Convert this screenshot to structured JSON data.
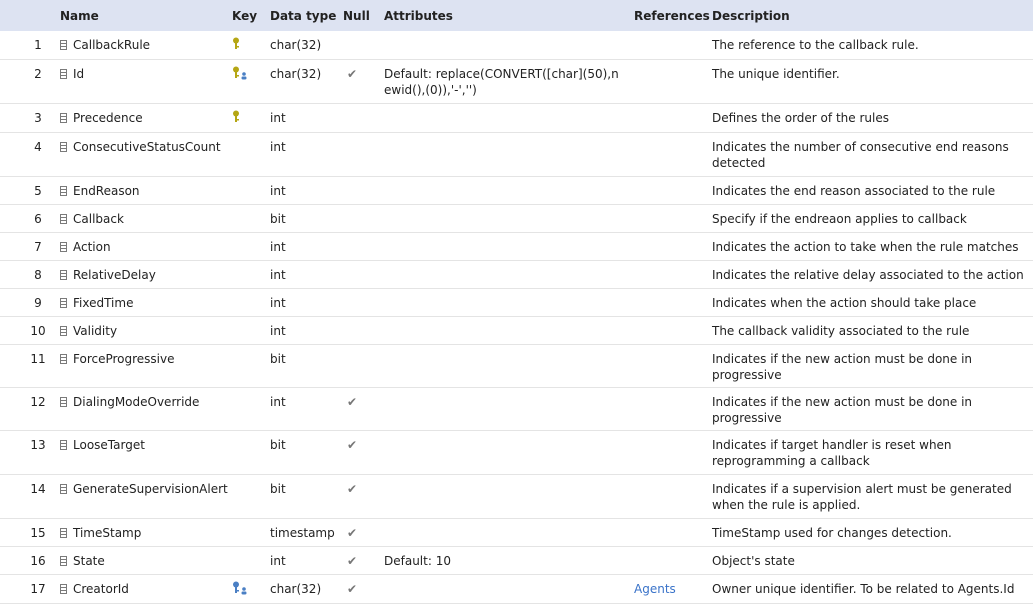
{
  "headers": {
    "num": "",
    "name": "Name",
    "key": "Key",
    "datatype": "Data type",
    "null": "Null",
    "attributes": "Attributes",
    "references": "References",
    "description": "Description"
  },
  "colors": {
    "header_bg": "#dde3f2",
    "pk_key": "#b5a614",
    "fk_key": "#4a7fc4",
    "link": "#3a73c9"
  },
  "rows": [
    {
      "num": "1",
      "name": "CallbackRule",
      "key": "pk",
      "datatype": "char(32)",
      "null": "",
      "attributes": "",
      "references": "",
      "description": "The reference to the callback rule."
    },
    {
      "num": "2",
      "name": "Id",
      "key": "pk-unique",
      "datatype": "char(32)",
      "null": "✔",
      "attributes": "Default: replace(CONVERT([char](50),newid(),(0)),'-','')",
      "references": "",
      "description": "The unique identifier."
    },
    {
      "num": "3",
      "name": "Precedence",
      "key": "pk",
      "datatype": "int",
      "null": "",
      "attributes": "",
      "references": "",
      "description": "Defines the order of the rules"
    },
    {
      "num": "4",
      "name": "ConsecutiveStatusCount",
      "key": "",
      "datatype": "int",
      "null": "",
      "attributes": "",
      "references": "",
      "description": "Indicates the number of consecutive end reasons detected"
    },
    {
      "num": "5",
      "name": "EndReason",
      "key": "",
      "datatype": "int",
      "null": "",
      "attributes": "",
      "references": "",
      "description": "Indicates the end reason associated to the rule"
    },
    {
      "num": "6",
      "name": "Callback",
      "key": "",
      "datatype": "bit",
      "null": "",
      "attributes": "",
      "references": "",
      "description": "Specify if the endreaon applies to callback"
    },
    {
      "num": "7",
      "name": "Action",
      "key": "",
      "datatype": "int",
      "null": "",
      "attributes": "",
      "references": "",
      "description": "Indicates the action to take when the rule matches"
    },
    {
      "num": "8",
      "name": "RelativeDelay",
      "key": "",
      "datatype": "int",
      "null": "",
      "attributes": "",
      "references": "",
      "description": "Indicates the relative delay associated to the action"
    },
    {
      "num": "9",
      "name": "FixedTime",
      "key": "",
      "datatype": "int",
      "null": "",
      "attributes": "",
      "references": "",
      "description": "Indicates when the action should take place"
    },
    {
      "num": "10",
      "name": "Validity",
      "key": "",
      "datatype": "int",
      "null": "",
      "attributes": "",
      "references": "",
      "description": "The callback validity associated to the rule"
    },
    {
      "num": "11",
      "name": "ForceProgressive",
      "key": "",
      "datatype": "bit",
      "null": "",
      "attributes": "",
      "references": "",
      "description": "Indicates if the new action must be done in progressive"
    },
    {
      "num": "12",
      "name": "DialingModeOverride",
      "key": "",
      "datatype": "int",
      "null": "✔",
      "attributes": "",
      "references": "",
      "description": "Indicates if the new action must be done in progressive"
    },
    {
      "num": "13",
      "name": "LooseTarget",
      "key": "",
      "datatype": "bit",
      "null": "✔",
      "attributes": "",
      "references": "",
      "description": "Indicates if target handler is reset when reprogramming a callback"
    },
    {
      "num": "14",
      "name": "GenerateSupervisionAlert",
      "key": "",
      "datatype": "bit",
      "null": "✔",
      "attributes": "",
      "references": "",
      "description": "Indicates if a supervision alert must be generated when the rule is applied."
    },
    {
      "num": "15",
      "name": "TimeStamp",
      "key": "",
      "datatype": "timestamp",
      "null": "✔",
      "attributes": "",
      "references": "",
      "description": "TimeStamp used for changes detection."
    },
    {
      "num": "16",
      "name": "State",
      "key": "",
      "datatype": "int",
      "null": "✔",
      "attributes": "Default: 10",
      "references": "",
      "description": "Object's state"
    },
    {
      "num": "17",
      "name": "CreatorId",
      "key": "fk",
      "datatype": "char(32)",
      "null": "✔",
      "attributes": "",
      "references": "Agents",
      "description": "Owner unique identifier. To be related to Agents.Id"
    }
  ]
}
